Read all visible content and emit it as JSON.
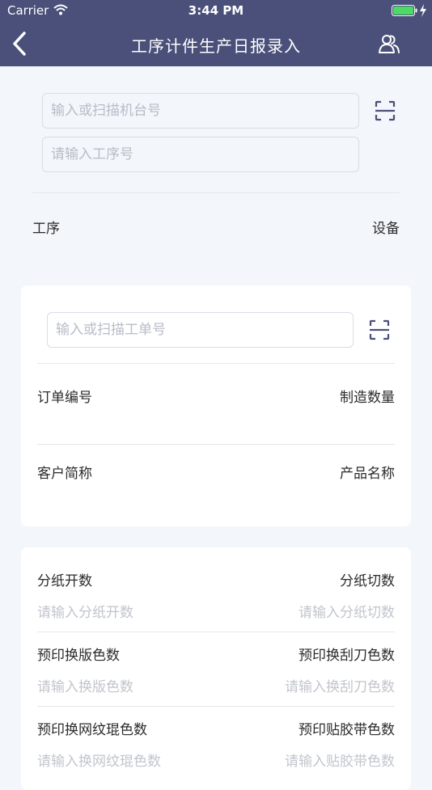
{
  "status_bar": {
    "carrier": "Carrier",
    "time": "3:44 PM"
  },
  "nav": {
    "title": "工序计件生产日报录入"
  },
  "machine_section": {
    "machine_input_placeholder": "输入或扫描机台号",
    "process_input_placeholder": "请输入工序号",
    "process_label": "工序",
    "equipment_label": "设备"
  },
  "order_card": {
    "order_input_placeholder": "输入或扫描工单号",
    "order_no_label": "订单编号",
    "quantity_label": "制造数量",
    "customer_label": "客户简称",
    "product_label": "产品名称"
  },
  "entry_card": {
    "rows": [
      {
        "left_label": "分纸开数",
        "left_placeholder": "请输入分纸开数",
        "right_label": "分纸切数",
        "right_placeholder": "请输入分纸切数"
      },
      {
        "left_label": "预印换版色数",
        "left_placeholder": "请输入换版色数",
        "right_label": "预印换刮刀色数",
        "right_placeholder": "请输入换刮刀色数"
      },
      {
        "left_label": "预印换网纹琨色数",
        "left_placeholder": "请输入换网纹琨色数",
        "right_label": "预印贴胶带色数",
        "right_placeholder": "请输入贴胶带色数"
      }
    ]
  }
}
